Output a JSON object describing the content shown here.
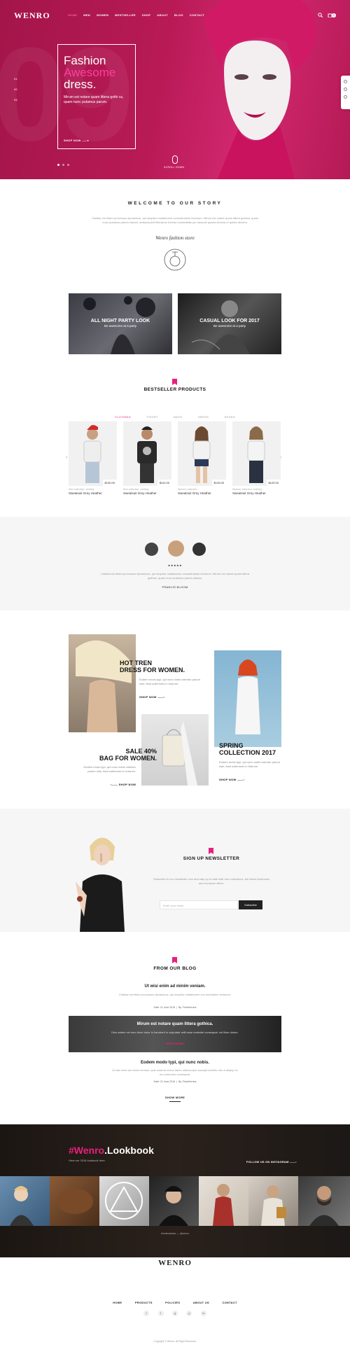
{
  "brand": {
    "logo": "WENRO",
    "accent": "#e8207c"
  },
  "nav": {
    "items": [
      "HOME",
      "MEN",
      "WOMEN",
      "BESTSELLER",
      "SHOP",
      "ABOUT",
      "BLOG",
      "CONTACT"
    ],
    "cart_count": "0"
  },
  "hero": {
    "title_line1": "Fashion",
    "title_line2": "Awesome",
    "title_line3": "dress.",
    "description": "Mirum est notare quam littera gothi ca, quam nunc putamus parum.",
    "cta": "SHOP NOW",
    "side_numbers": [
      "01.",
      "02.",
      "03."
    ],
    "scroll_label": "SCROLL DOWN"
  },
  "story": {
    "title": "WELCOME TO OUR STORY",
    "text": "Claritas est etiam processus dynamicus, qui sequitur mutationem consuetudium lectorum. Mirum est notare quam littera gothica, quam nunc putamus parum claram, anteposuerit litterarum formas humanitatis per seacula quarta decima et quinta decima.",
    "signature": "Wenro fashion store"
  },
  "banners": [
    {
      "title": "ALL NIGHT PARTY LOOK",
      "sub": "Be awesome at a party"
    },
    {
      "title": "CASUAL LOOK FOR 2017",
      "sub": "Be awesome at a party"
    }
  ],
  "bestseller": {
    "title": "BESTSELLER PRODUCTS",
    "tabs": [
      "CLOTHING",
      "TSHIRT",
      "BAGS",
      "DRESS",
      "SHOES"
    ],
    "products": [
      {
        "category": "Men collection, clothing",
        "name": "Sweatsuit Grey Heather",
        "price": "$130.00"
      },
      {
        "category": "Men collection, clothing",
        "name": "Sweatsuit Grey Heather",
        "price": "$112.00"
      },
      {
        "category": "Women collection",
        "name": "Sweatsuit Grey Heather",
        "price": "$125.00"
      },
      {
        "category": "Women collection, clothing",
        "name": "Sweatsuit Grey Heather",
        "price": "$120.00"
      }
    ]
  },
  "testimonial": {
    "stars": "★★★★★",
    "text": "Claritas est etiam processus dynamicus, qui sequitur mutationem consuetudium lectorum. Mirum est notare quam littera gothica, quam nunc putamus parum claram.",
    "author": "FRANCIS BLOOM"
  },
  "promos": {
    "women": {
      "line1": "HOT TREN",
      "line2": "DRESS FOR WOMEN.",
      "text": "Eodem modo typi, qui nunc nobis videntur parum clari, fiant sollemnes in futurum.",
      "cta": "SHOP NOW"
    },
    "sale": {
      "line1": "SALE 40%",
      "line2": "BAG FOR WOMEN.",
      "text": "Eodem modo typi, qui nunc nobis videntur parum clari, fiant sollemnes in futurum.",
      "cta": "SHOP NOW"
    },
    "spring": {
      "line1": "SPRING",
      "line2": "COLLECTION 2017",
      "text": "Eodem modo typi, qui nunc nobis videntur parum clari, fiant sollemnes in futurum.",
      "cta": "SHOP NOW"
    }
  },
  "newsletter": {
    "title": "SIGN UP NEWSLETTER",
    "text": "Subscribe to our newsletter now and stay up to date with new collections, the latest lookbooks and exclusive offers.",
    "placeholder": "Enter your email",
    "button": "Subscribe"
  },
  "blog": {
    "title": "FROM OUR BLOG",
    "post1": {
      "title": "Ut wisi enim ad minim veniam.",
      "text": "Claritas est etiam processus dynamicus, qui sequitur mutationem con suetudium lectorum.",
      "date": "Date: 21 June 2016",
      "author": "By: FlavioKenna"
    },
    "banner": {
      "title": "Mirum est notare quam littera gothica.",
      "text": "Duis autem vel eum iriure dolor in hendrerit in vulputate velit esse molestie consequat, vel illum dolore.",
      "link": "READ MORE"
    },
    "post2": {
      "title": "Eodem modo typi, qui nunc nobis.",
      "text": "Ut wisi enim ad minim veniam, quis nostrud exerci tation ullamcorper suscipit lobortis nisl ut aliquip ex ea commodo consequat.",
      "date": "Date: 21 June 2016",
      "author": "By: FlavioKenna"
    },
    "more": "SHOW MORE"
  },
  "lookbook": {
    "title_hash": "#Wenro",
    "title_rest": ".Lookbook",
    "subtitle": "View our 2016 lookbook here",
    "follow": "FOLLOW US ON INSTAGRAM",
    "caption": "#minimalwear — @wenro"
  },
  "footer": {
    "logo": "WENRO",
    "nav": [
      "HOME",
      "PRODUCTS",
      "POLICIES",
      "ABOUT US",
      "CONTACT"
    ],
    "social": [
      "f",
      "t",
      "g",
      "p",
      "in"
    ],
    "copyright": "Copyright © Wenro. All Right Reserved."
  }
}
